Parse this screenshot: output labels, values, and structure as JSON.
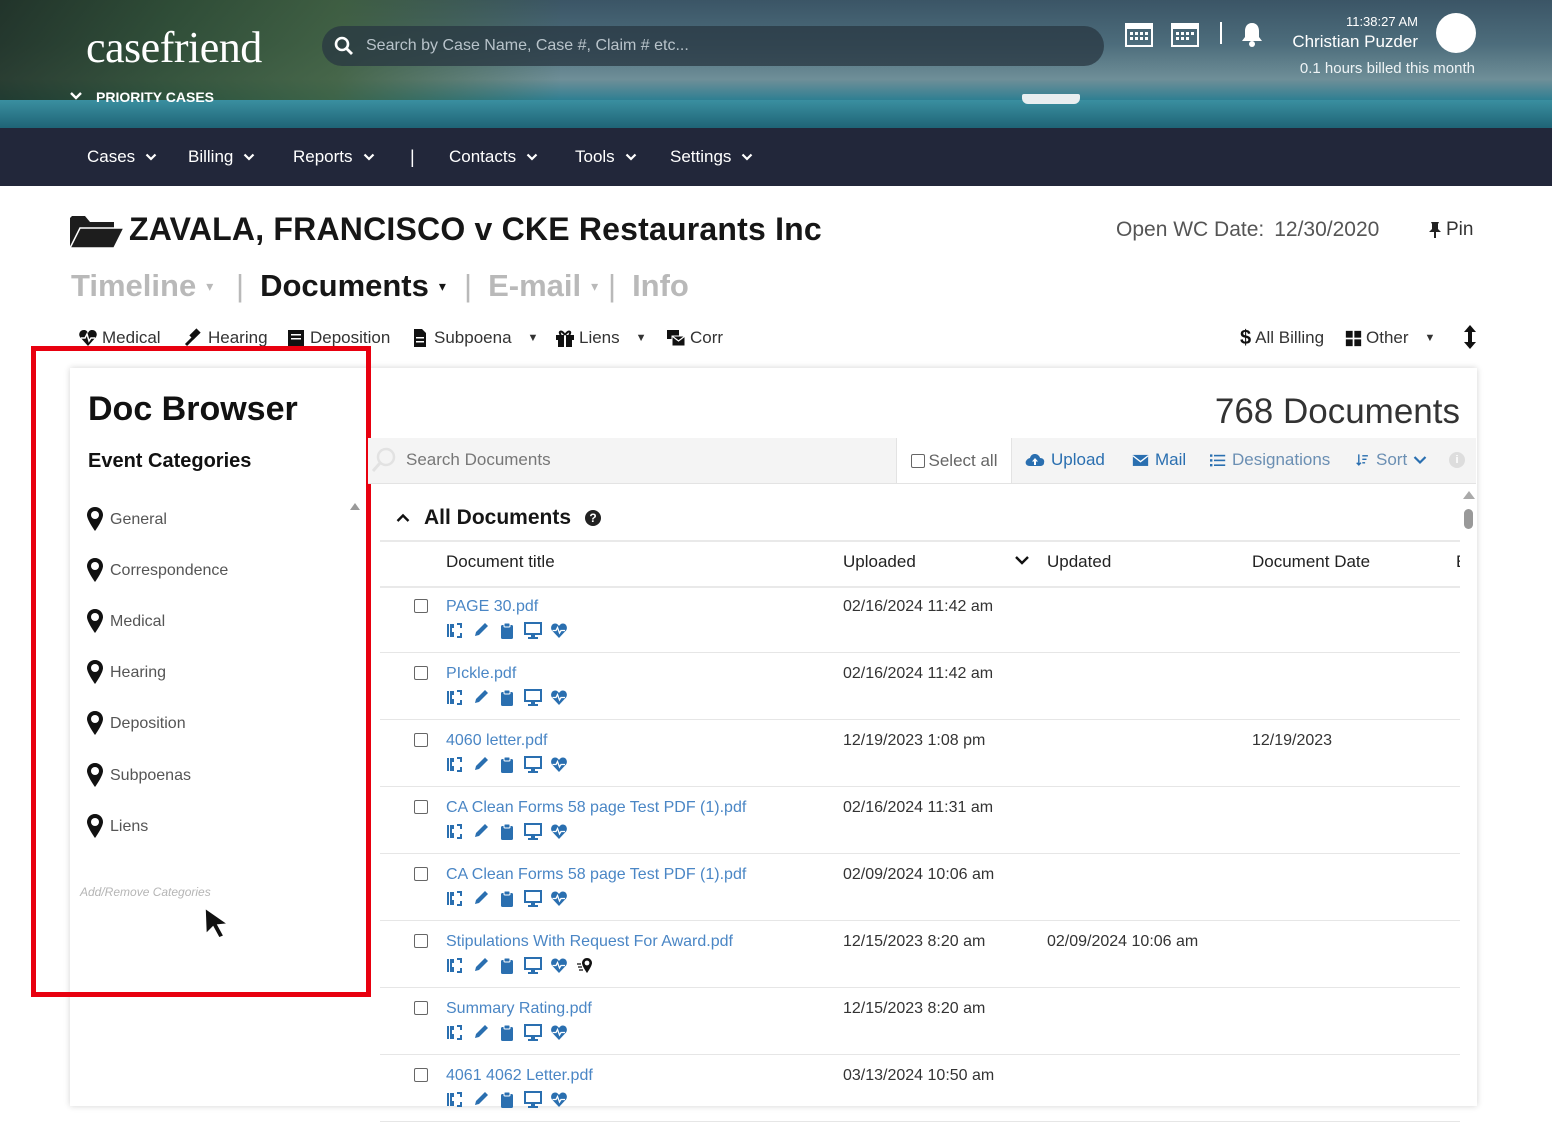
{
  "app": {
    "brand": "casefriend",
    "priority_cases": "PRIORITY CASES",
    "search_placeholder": "Search by Case Name, Case #, Claim # etc...",
    "time": "11:38:27 AM",
    "user_name": "Christian Puzder",
    "billed": "0.1 hours billed this month"
  },
  "nav": {
    "items": [
      "Cases",
      "Billing",
      "Reports",
      "Contacts",
      "Tools",
      "Settings"
    ],
    "separator": "|"
  },
  "case": {
    "title": "ZAVALA, FRANCISCO v CKE Restaurants Inc",
    "open_date_label": "Open WC Date:",
    "open_date_value": "12/30/2020",
    "pin_label": "Pin"
  },
  "tabs": [
    "Timeline",
    "Documents",
    "E-mail",
    "Info"
  ],
  "subnav": {
    "items": [
      "Medical",
      "Hearing",
      "Deposition",
      "Subpoena",
      "Liens",
      "Corr"
    ],
    "right": [
      "All Billing",
      "Other"
    ]
  },
  "doc_browser": {
    "title": "Doc Browser",
    "subtitle": "Event Categories",
    "categories": [
      "General",
      "Correspondence",
      "Medical",
      "Hearing",
      "Deposition",
      "Subpoenas",
      "Liens"
    ],
    "add_remove": "Add/Remove Categories"
  },
  "documents": {
    "count_label": "768 Documents",
    "search_placeholder": "Search Documents",
    "select_all": "Select all",
    "upload": "Upload",
    "mail": "Mail",
    "designations": "Designations",
    "sort": "Sort",
    "section_title": "All Documents",
    "columns": [
      "Document title",
      "Uploaded",
      "Updated",
      "Document Date",
      "E"
    ],
    "rows": [
      {
        "title": "PAGE 30.pdf",
        "uploaded": "02/16/2024 11:42 am",
        "updated": "",
        "doc_date": ""
      },
      {
        "title": "PIckle.pdf",
        "uploaded": "02/16/2024 11:42 am",
        "updated": "",
        "doc_date": ""
      },
      {
        "title": "4060 letter.pdf",
        "uploaded": "12/19/2023 1:08 pm",
        "updated": "",
        "doc_date": "12/19/2023"
      },
      {
        "title": "CA Clean Forms 58 page Test PDF (1).pdf",
        "uploaded": "02/16/2024 11:31 am",
        "updated": "",
        "doc_date": ""
      },
      {
        "title": "CA Clean Forms 58 page Test PDF (1).pdf",
        "uploaded": "02/09/2024 10:06 am",
        "updated": "",
        "doc_date": ""
      },
      {
        "title": "Stipulations With Request For Award.pdf",
        "uploaded": "12/15/2023 8:20 am",
        "updated": "02/09/2024 10:06 am",
        "doc_date": ""
      },
      {
        "title": "Summary Rating.pdf",
        "uploaded": "12/15/2023 8:20 am",
        "updated": "",
        "doc_date": ""
      },
      {
        "title": "4061 4062 Letter.pdf",
        "uploaded": "03/13/2024 10:50 am",
        "updated": "",
        "doc_date": ""
      }
    ]
  },
  "colors": {
    "nav_bg": "#22273a",
    "link_blue": "#4a86c5",
    "action_blue": "#2a6fb0",
    "highlight_red": "#e8000f"
  }
}
